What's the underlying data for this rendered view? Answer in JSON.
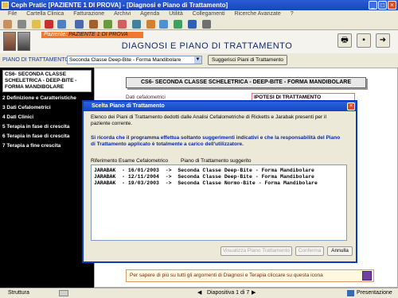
{
  "window": {
    "title": "Ceph Pratic [PAZIENTE 1 DI PROVA] - [Diagnosi e Piano di Trattamento]"
  },
  "menu": [
    "File",
    "Cartella Clinica",
    "Fatturazione",
    "Archivi",
    "Agenda",
    "Utilità",
    "Collegamenti",
    "Ricerche Avanzate",
    "?"
  ],
  "header": {
    "patient_label": "Paziente",
    "patient_name": "PAZIENTE 1 DI PROVA",
    "page_title": "DIAGNOSI E PIANO DI TRATTAMENTO"
  },
  "piano": {
    "label": "PIANO DI TRATTAMENTO:",
    "selected": "Seconda Classe Deep-Bite - Forma Mandibolare",
    "suggest_button": "Suggerisci Piani di Trattamento"
  },
  "sidebar": {
    "first": "CS6- SECONDA CLASSE SCHELETRICA - DEEP-BITE - FORMA MANDIBOLARE",
    "items": [
      "2 Definizione e Caratteristiche",
      "3 Dati Cefalometrici",
      "4 Dati Clinici",
      "5 Terapia in fase di crescita",
      "6 Terapia in fase di crescita",
      "7 Terapia a fine crescita"
    ]
  },
  "main": {
    "title": "CS6- SECONDA CLASSE SCHELETRICA - DEEP-BITE - FORMA MANDIBOLARE",
    "left_heading": "Dati cefalometrici",
    "right_heading": "IPOTESI DI TRATTAMENTO",
    "bottom_note": "Per sapere di più su tutti gli argomenti di Diagnosi e Terapia cliccare su questa icona"
  },
  "dialog": {
    "title": "Scelta Piano di Trattamento",
    "intro": "Elenco dei Piani di Trattamento dedotti dalle Analisi Cefalometriche di Ricketts e Jarabak presenti per il paziente corrente.",
    "warning": "Si ricorda che il programma effettua soltanto suggerimenti indicativi e che la responsabilità del Piano di Trattamento applicato è totalmente a carico dell'utilizzatore.",
    "col_ref": "Riferimento Esame Cefalometrico",
    "col_plan": "Piano di Trattamento suggerito",
    "rows": [
      "JARABAK  - 16/01/2003  ->  Seconda Classe Deep-Bite - Forma Mandibolare",
      "JARABAK  - 12/11/2004  ->  Seconda Classe Deep-Bite - Forma Mandibolare",
      "JARABAK  - 19/03/2003  ->  Seconda Classe Normo-Bite - Forma Mandibolare"
    ],
    "btn_show": "Visualizza Piano Trattamento",
    "btn_confirm": "Conferma",
    "btn_cancel": "Annulla"
  },
  "statusbar": {
    "left": "Struttura",
    "middle": "Diapositiva 1 di 7",
    "right": "Presentazione"
  }
}
